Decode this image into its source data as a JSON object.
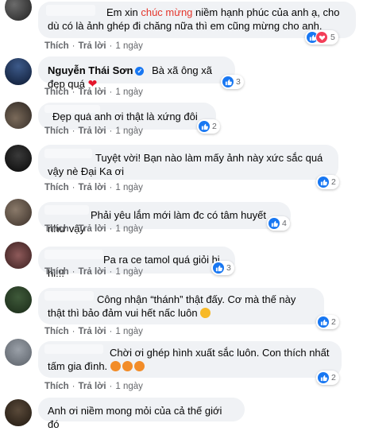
{
  "common": {
    "like": "Thích",
    "reply": "Trả lời",
    "sep": "·"
  },
  "comments": [
    {
      "author": "",
      "text_a": "Em xin ",
      "text_highlight": "chúc mừng",
      "text_b": " niềm hạnh phúc của anh ạ, cho dù có là ảnh ghép đi chăng nữa thì em cũng mừng cho anh.",
      "time": "1 ngày",
      "reactions": [
        "like",
        "love"
      ],
      "count": "5"
    },
    {
      "author": "Nguyễn Thái Sơn",
      "text": "Bà xã ông xã đẹp quá ",
      "time": "1 ngày",
      "reactions": [
        "like"
      ],
      "count": "3"
    },
    {
      "text": "Đẹp quá anh ơi thật là xứng đôi",
      "time": "1 ngày",
      "reactions": [
        "like"
      ],
      "count": "2"
    },
    {
      "text": "Tuyệt vời! Bạn nào làm mấy ảnh này xức sắc quá vậy nè Đại Ka ơi",
      "time": "1 ngày",
      "reactions": [
        "like"
      ],
      "count": "2"
    },
    {
      "text": "Phải yêu lắm mới làm đc có tâm huyết như vậy",
      "time": "1 ngày",
      "reactions": [
        "like"
      ],
      "count": "4"
    },
    {
      "text": "Pa ra ce tamol quá giỏi hi hi!!!",
      "time": "1 ngày",
      "reactions": [
        "like"
      ],
      "count": "3"
    },
    {
      "text": "Công nhận “thánh” thật đấy. Cơ mà thế này thật thì bảo đảm vui hết nấc luôn",
      "time": "1 ngày",
      "reactions": [
        "like"
      ],
      "count": "2"
    },
    {
      "text": "Chời ơi ghép hình xuất sắc luôn. Con thích nhất tấm gia đình.",
      "time": "1 ngày",
      "reactions": [
        "like"
      ],
      "count": "2"
    },
    {
      "text": "Anh ơi niềm mong mỏi của cả thế giới đó"
    }
  ]
}
